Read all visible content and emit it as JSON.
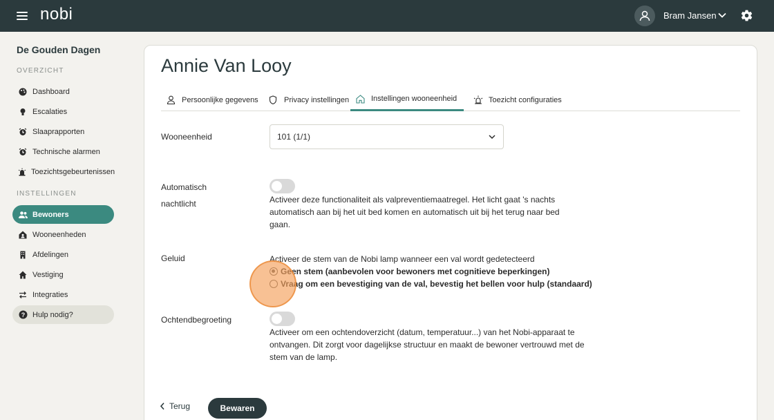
{
  "header": {
    "logo": "nobi",
    "user_name": "Bram Jansen"
  },
  "sidebar": {
    "org_name": "De Gouden Dagen",
    "overview_title": "OVERZICHT",
    "settings_title": "INSTELLINGEN",
    "overview_items": [
      {
        "label": "Dashboard",
        "icon": "palette-icon"
      },
      {
        "label": "Escalaties",
        "icon": "lightbulb-icon"
      },
      {
        "label": "Slaaprapporten",
        "icon": "alarm-clock-icon"
      },
      {
        "label": "Technische alarmen",
        "icon": "alarm-clock-icon"
      },
      {
        "label": "Toezichtsgebeurtenissen",
        "icon": "siren-icon"
      }
    ],
    "settings_items": [
      {
        "label": "Bewoners",
        "icon": "people-icon",
        "active": true
      },
      {
        "label": "Wooneenheden",
        "icon": "home-user-icon"
      },
      {
        "label": "Afdelingen",
        "icon": "building-icon"
      },
      {
        "label": "Vestiging",
        "icon": "house-icon"
      },
      {
        "label": "Integraties",
        "icon": "swap-arrows-icon"
      }
    ],
    "help_label": "Hulp nodig?"
  },
  "main": {
    "title": "Annie Van Looy",
    "tabs": [
      {
        "label": "Persoonlijke gegevens",
        "icon": "person-icon"
      },
      {
        "label": "Privacy instellingen",
        "icon": "shield-icon"
      },
      {
        "label": "Instellingen wooneenheid",
        "icon": "home-icon",
        "active": true
      },
      {
        "label": "Toezicht configuraties",
        "icon": "siren-icon"
      }
    ],
    "unit_label": "Wooneenheid",
    "unit_value": "101 (1/1)",
    "nightlight": {
      "label_line1": "Automatisch",
      "label_line2": "nachtlicht",
      "enabled": false,
      "description": "Activeer deze functionaliteit als valpreventiemaatregel. Het licht gaat 's nachts automatisch aan bij het uit bed komen en automatisch uit bij het terug naar bed gaan."
    },
    "sound": {
      "label": "Geluid",
      "description": "Activeer de stem van de Nobi lamp wanneer een val wordt gedetecteerd",
      "options": [
        {
          "label": "Geen stem (aanbevolen voor bewoners met cognitieve beperkingen)",
          "checked": true
        },
        {
          "label": "Vraag om een bevestiging van de val, bevestig het bellen voor hulp (standaard)",
          "checked": false
        }
      ]
    },
    "greeting": {
      "label": "Ochtendbegroeting",
      "enabled": false,
      "description": "Activeer om een ochtendoverzicht (datum, temperatuur...) van het Nobi-apparaat te ontvangen. Dit zorgt voor dagelijkse structuur en maakt de bewoner vertrouwd met de stem van de lamp."
    },
    "back_label": "Terug",
    "save_label": "Bewaren"
  },
  "colors": {
    "topbar": "#2b3a3d",
    "accent": "#3b8a80",
    "background": "#f3f2ee"
  }
}
